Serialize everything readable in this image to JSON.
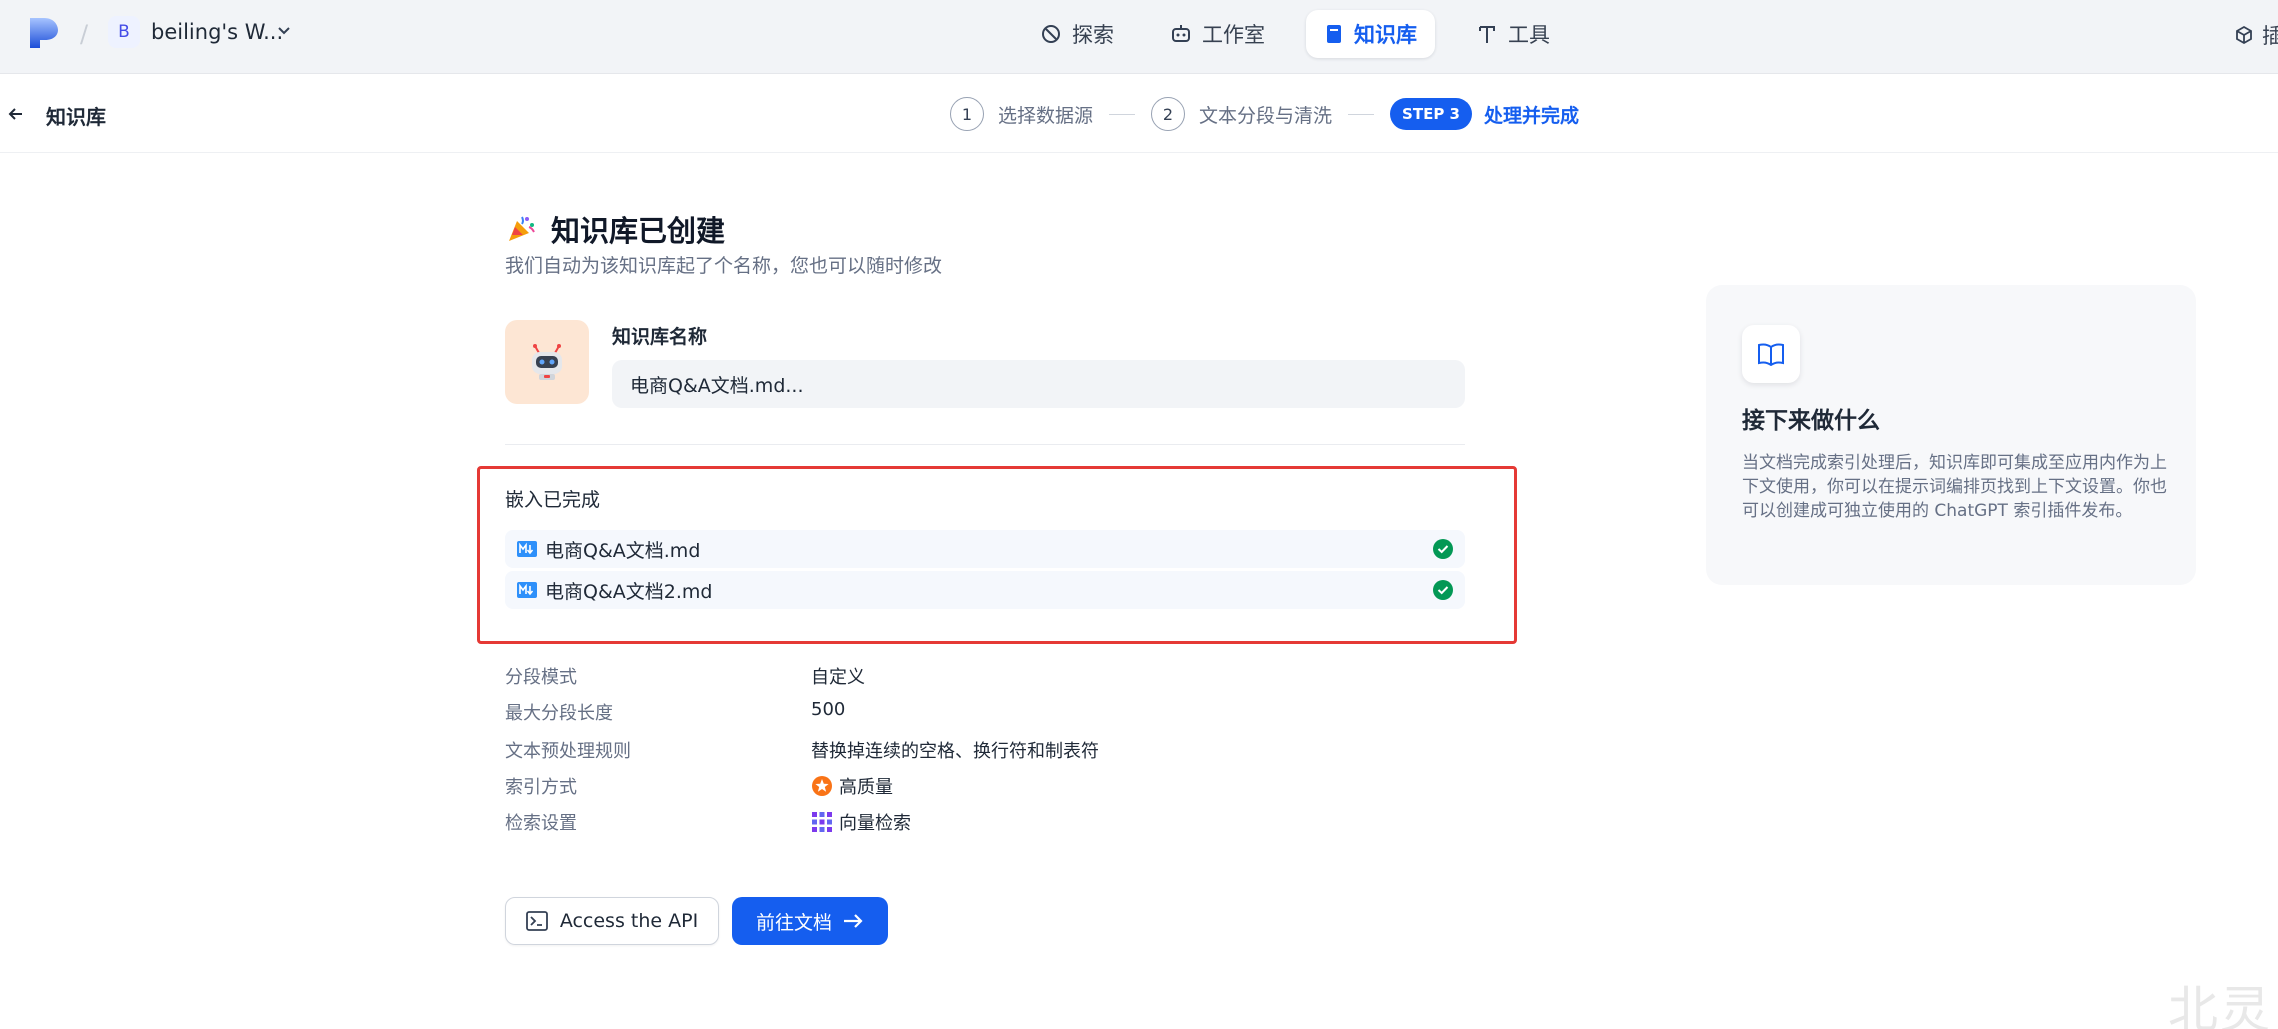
{
  "topbar": {
    "workspace_badge": "B",
    "workspace_name": "beiling's W...",
    "nav": [
      {
        "label": "探索",
        "icon": "explore-icon"
      },
      {
        "label": "工作室",
        "icon": "robot-icon"
      },
      {
        "label": "知识库",
        "icon": "book-icon",
        "active": true
      },
      {
        "label": "工具",
        "icon": "tool-icon"
      }
    ],
    "right_edge_text": "插"
  },
  "subhead": {
    "back_title": "知识库",
    "steps": [
      {
        "num": "1",
        "label": "选择数据源"
      },
      {
        "num": "2",
        "label": "文本分段与清洗"
      },
      {
        "num": "STEP 3",
        "label": "处理并完成",
        "active": true
      }
    ]
  },
  "main": {
    "title": "知识库已创建",
    "subtitle": "我们自动为该知识库起了个名称，您也可以随时修改",
    "name_label": "知识库名称",
    "name_value": "电商Q&A文档.md...",
    "embed_title": "嵌入已完成",
    "files": [
      {
        "name": "电商Q&A文档.md",
        "status": "done"
      },
      {
        "name": "电商Q&A文档2.md",
        "status": "done"
      }
    ],
    "meta": [
      {
        "label": "分段模式",
        "value": "自定义"
      },
      {
        "label": "最大分段长度",
        "value": "500"
      },
      {
        "label": "文本预处理规则",
        "value": "替换掉连续的空格、换行符和制表符"
      },
      {
        "label": "索引方式",
        "value": "高质量",
        "icon": "star-badge-icon"
      },
      {
        "label": "检索设置",
        "value": "向量检索",
        "icon": "grid-dots-icon"
      }
    ],
    "api_button": "Access the API",
    "doc_button": "前往文档"
  },
  "next_panel": {
    "title": "接下来做什么",
    "text": "当文档完成索引处理后，知识库即可集成至应用内作为上下文使用，你可以在提示词编排页找到上下文设置。你也可以创建成可独立使用的 ChatGPT 索引插件发布。"
  },
  "watermark": "北灵",
  "colors": {
    "accent": "#155eef",
    "success": "#039855",
    "highlight_border": "#e53935"
  }
}
